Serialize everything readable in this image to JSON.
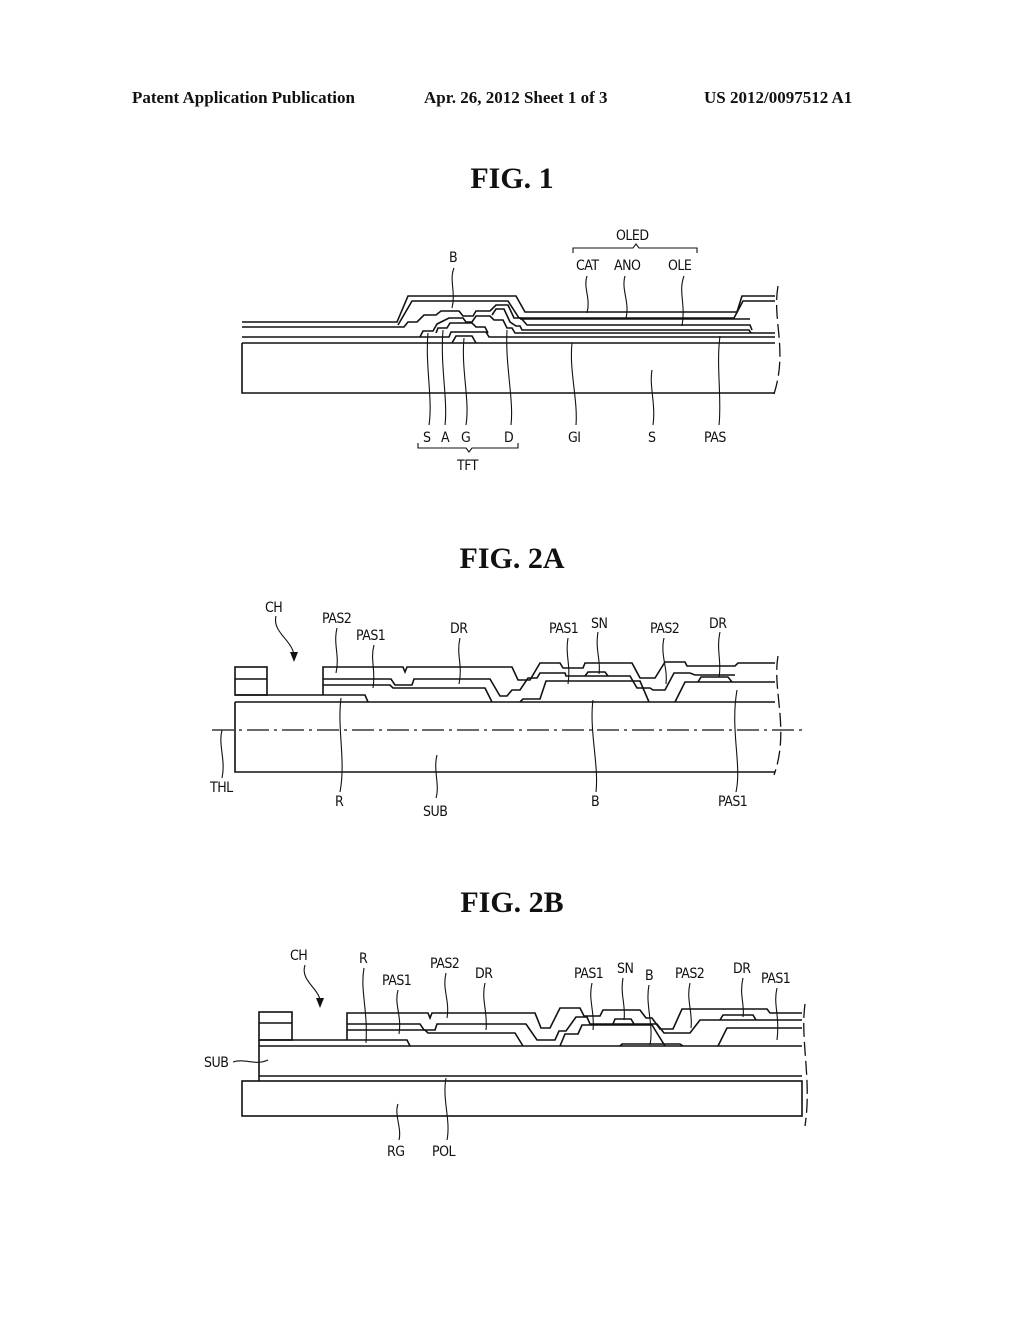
{
  "header": {
    "publication_type": "Patent Application Publication",
    "date_sheet": "Apr. 26, 2012  Sheet 1 of 3",
    "publication_number": "US 2012/0097512 A1"
  },
  "figures": [
    {
      "title": "FIG. 1",
      "labels": {
        "oled_group": "OLED",
        "cat": "CAT",
        "ano": "ANO",
        "ole": "OLE",
        "bank": "B",
        "s1": "S",
        "a": "A",
        "g": "G",
        "d": "D",
        "tft_group": "TFT",
        "gi": "GI",
        "s2": "S",
        "pas": "PAS"
      }
    },
    {
      "title": "FIG. 2A",
      "labels": {
        "ch": "CH",
        "pas2_left": "PAS2",
        "pas1_left": "PAS1",
        "dr_left": "DR",
        "pas1_mid": "PAS1",
        "sn": "SN",
        "pas2_right": "PAS2",
        "dr_right": "DR",
        "thl": "THL",
        "r": "R",
        "sub": "SUB",
        "b": "B",
        "pas1_bottom": "PAS1"
      }
    },
    {
      "title": "FIG. 2B",
      "labels": {
        "ch": "CH",
        "r": "R",
        "pas1_left": "PAS1",
        "pas2_left": "PAS2",
        "dr_left": "DR",
        "pas1_mid": "PAS1",
        "sn": "SN",
        "b": "B",
        "pas2_right": "PAS2",
        "dr_right": "DR",
        "pas1_right": "PAS1",
        "sub": "SUB",
        "rg": "RG",
        "pol": "POL"
      }
    }
  ]
}
